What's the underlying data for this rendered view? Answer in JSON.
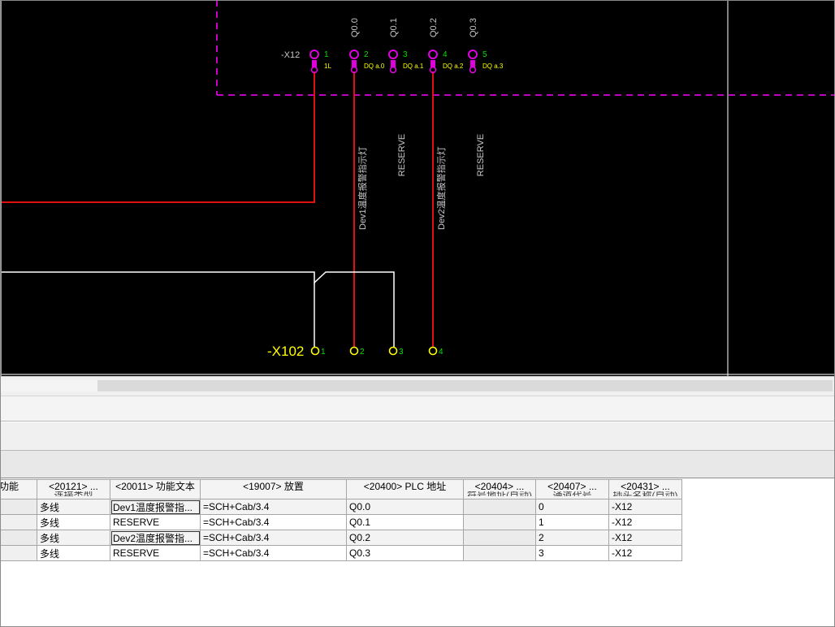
{
  "schematic": {
    "terminal_strip_top": "-X12",
    "terminal_strip_bottom": "-X102",
    "top_terminals": [
      {
        "num": "1",
        "label": "1L",
        "addr": ""
      },
      {
        "num": "2",
        "label": "DQ a.0",
        "addr": "Q0.0"
      },
      {
        "num": "3",
        "label": "DQ a.1",
        "addr": "Q0.1"
      },
      {
        "num": "4",
        "label": "DQ a.2",
        "addr": "Q0.2"
      },
      {
        "num": "5",
        "label": "DQ a.3",
        "addr": "Q0.3"
      }
    ],
    "bottom_terminals": [
      "1",
      "2",
      "3",
      "4"
    ],
    "function_texts": [
      "Dev1温度报警指示灯",
      "RESERVE",
      "Dev2温度报警指示灯",
      "RESERVE"
    ],
    "colors": {
      "background": "#000000",
      "plc_terminal": "#e000e0",
      "wire_red": "#e01010",
      "wire_white": "#ffffff",
      "terminal_yellow": "#ffff00",
      "number_green": "#00e000",
      "dashed_box": "#ff00ff",
      "text_gray": "#c8c8c8"
    }
  },
  "grid": {
    "columns": [
      {
        "label": "功能",
        "sub": ""
      },
      {
        "label": "<20121> ...",
        "sub": "连接类型"
      },
      {
        "label": "<20011> 功能文本",
        "sub": ""
      },
      {
        "label": "<19007> 放置",
        "sub": ""
      },
      {
        "label": "<20400> PLC 地址",
        "sub": ""
      },
      {
        "label": "<20404> ...",
        "sub": "符号地址(自动)"
      },
      {
        "label": "<20407> ...",
        "sub": "通道代号"
      },
      {
        "label": "<20431> ...",
        "sub": "插头名称(自动)"
      }
    ],
    "rows": [
      [
        "",
        "多线",
        "Dev1温度报警指...",
        "=SCH+Cab/3.4",
        "Q0.0",
        "",
        "0",
        "-X12"
      ],
      [
        "",
        "多线",
        "RESERVE",
        "=SCH+Cab/3.4",
        "Q0.1",
        "",
        "1",
        "-X12"
      ],
      [
        "",
        "多线",
        "Dev2温度报警指...",
        "=SCH+Cab/3.4",
        "Q0.2",
        "",
        "2",
        "-X12"
      ],
      [
        "",
        "多线",
        "RESERVE",
        "=SCH+Cab/3.4",
        "Q0.3",
        "",
        "3",
        "-X12"
      ]
    ]
  }
}
